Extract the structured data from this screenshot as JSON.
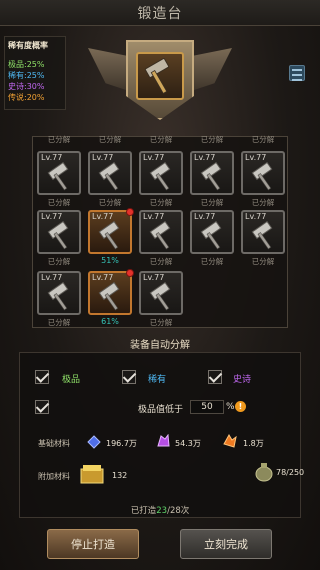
{
  "title": "锻造台",
  "rarity": {
    "title": "稀有度概率",
    "lines": [
      "极品:25%",
      "稀有:25%",
      "史诗:30%",
      "传说:20%"
    ]
  },
  "grid": {
    "level": "Lv.77",
    "sub_label": "已分解",
    "prev_row_labels": [
      "已分解",
      "已分解",
      "已分解",
      "已分解",
      "已分解"
    ],
    "row2_orange_percent": "51%",
    "row3_orange_percent": "61%"
  },
  "auto": {
    "title": "装备自动分解",
    "options": [
      "极品",
      "稀有",
      "史诗"
    ],
    "quality_label": "极品值低于",
    "quality_value": "50",
    "percent_sign": "%",
    "warn": "!"
  },
  "materials": {
    "basic_label": "基础材料",
    "basic": [
      "196.7万",
      "54.3万",
      "1.8万"
    ],
    "extra_label": "附加材料",
    "extra_value": "132",
    "bag": "78/250"
  },
  "progress": {
    "prefix": "已打造",
    "current": "23",
    "total": "/28次"
  },
  "buttons": {
    "stop": "停止打造",
    "finish": "立刻完成"
  },
  "colors": {
    "jipin": "#8fe068",
    "xiyou": "#4fb8f2",
    "shishi": "#c068f0",
    "chuanshuo": "#f2a234"
  }
}
